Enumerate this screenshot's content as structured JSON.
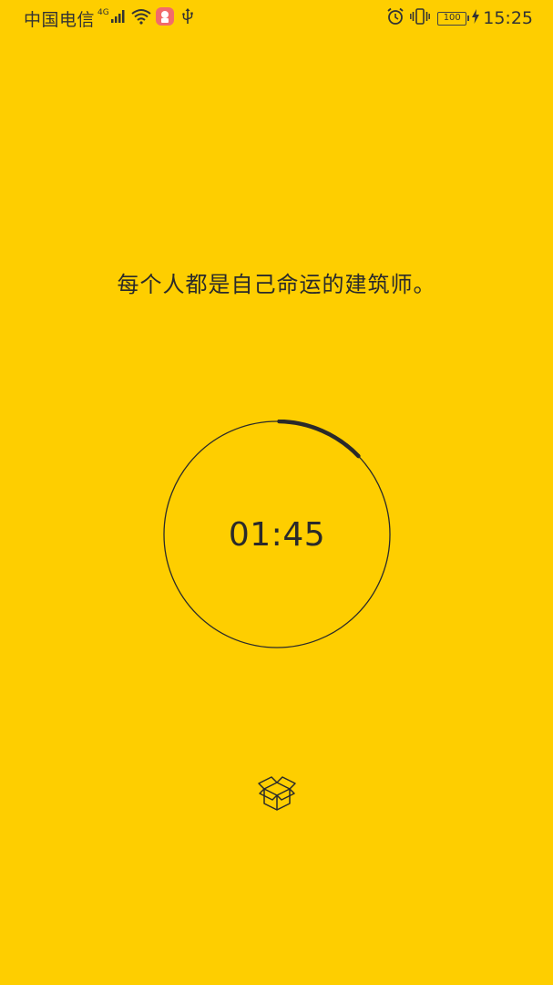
{
  "status_bar": {
    "carrier": "中国电信",
    "network_type": "4G",
    "battery_level": "100",
    "time": "15:25",
    "icons": [
      "signal-icon",
      "wifi-icon",
      "app-notification-icon",
      "usb-icon",
      "alarm-icon",
      "vibrate-icon",
      "battery-icon",
      "charging-icon"
    ]
  },
  "main": {
    "quote": "每个人都是自己命运的建筑师。",
    "timer": {
      "time_display": "01:45",
      "progress_fraction": 0.125
    },
    "box_button": {
      "icon": "box-icon"
    }
  },
  "colors": {
    "background": "#FECE00",
    "text": "#2a2a2a",
    "ring": "#2a2a2a"
  }
}
